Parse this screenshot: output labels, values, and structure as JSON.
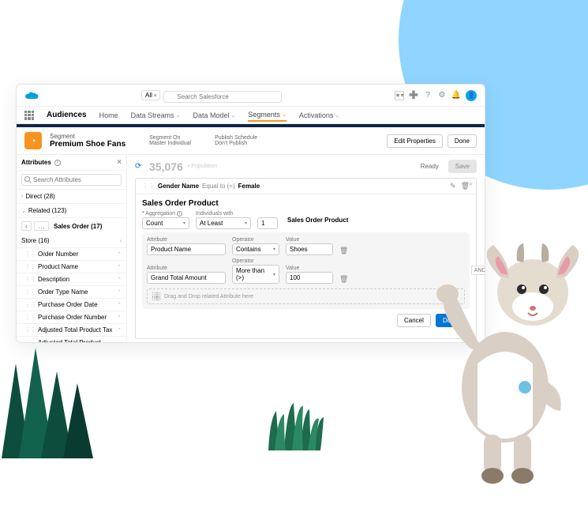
{
  "topbar": {
    "all_label": "All",
    "search_placeholder": "Search Salesforce"
  },
  "nav": {
    "title": "Audiences",
    "items": [
      "Home",
      "Data Streams",
      "Data Model",
      "Segments",
      "Activations"
    ],
    "active": "Segments"
  },
  "segment": {
    "label": "Segment",
    "name": "Premium Shoe Fans",
    "on_label": "Segment On",
    "on_value": "Master Individual",
    "sched_label": "Publish Schedule",
    "sched_value": "Don't Publish",
    "edit_btn": "Edit Properties",
    "done_btn": "Done"
  },
  "sidebar": {
    "head": "Attributes",
    "search_placeholder": "Search Attributes",
    "direct": "Direct (28)",
    "related": "Related (123)",
    "crumb_label": "Sales Order (17)",
    "store": "Store (16)",
    "attrs": [
      "Order Number",
      "Product Name",
      "Description",
      "Order Type Name",
      "Purchase Order Date",
      "Purchase Order Number",
      "Adjusted Total Product Tax",
      "Adjusted Total Product Amount"
    ]
  },
  "main": {
    "count": "35,076",
    "pop_label": "Population",
    "status": "Ready",
    "save": "Save"
  },
  "pill": {
    "field": "Gender Name",
    "op": "Equal to (=)",
    "value": "Female"
  },
  "rule": {
    "title": "Sales Order Product",
    "agg_label": "Aggregation",
    "agg_value": "Count",
    "ind_label": "Individuals with",
    "ind_value": "At Least",
    "num": "1",
    "object": "Sales Order Product",
    "f1": {
      "attr_label": "Attribute",
      "attr": "Product Name",
      "op_label": "Operator",
      "op": "Contains",
      "val_label": "Value",
      "val": "Shoes"
    },
    "f2": {
      "attr_label": "Attribute",
      "attr": "Grand Total Amount",
      "op_label": "Operator",
      "op": "More than (>)",
      "val_label": "Value",
      "val": "100"
    },
    "drop": "Drag and Drop related Attribute here",
    "cancel": "Cancel",
    "done": "Done",
    "and": "AND"
  }
}
